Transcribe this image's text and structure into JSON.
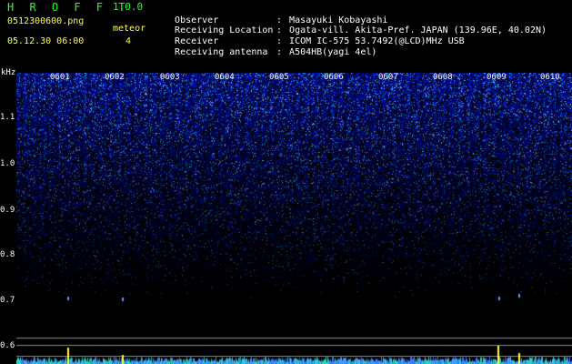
{
  "app": {
    "title": "H R O F F T",
    "version": "1.0.0"
  },
  "file": {
    "name": "0512300600.png",
    "datetime": "05.12.30 06:00"
  },
  "meteor": {
    "label": "meteor",
    "count": "4"
  },
  "info": [
    {
      "key": "Observer",
      "value": "Masayuki Kobayashi"
    },
    {
      "key": "Receiving Location",
      "value": "Ogata-vill. Akita-Pref. JAPAN (139.96E, 40.02N)"
    },
    {
      "key": "Receiver",
      "value": "ICOM IC-575 53.7492(@LCD)MHz USB"
    },
    {
      "key": "Receiving antenna",
      "value": "A504HB(yagi 4el)"
    }
  ],
  "axis": {
    "unit": "kHz",
    "y_ticks": [
      "1.1",
      "1.0",
      "0.9",
      "0.8",
      "0.7",
      "0.6"
    ],
    "x_ticks": [
      "0601",
      "0602",
      "0603",
      "0604",
      "0605",
      "0606",
      "0607",
      "0608",
      "0609",
      "0610"
    ]
  },
  "colors": {
    "title": "#28ff28",
    "meta": "#ffff40",
    "signal": "#1e3cff",
    "text": "#ffffff"
  }
}
